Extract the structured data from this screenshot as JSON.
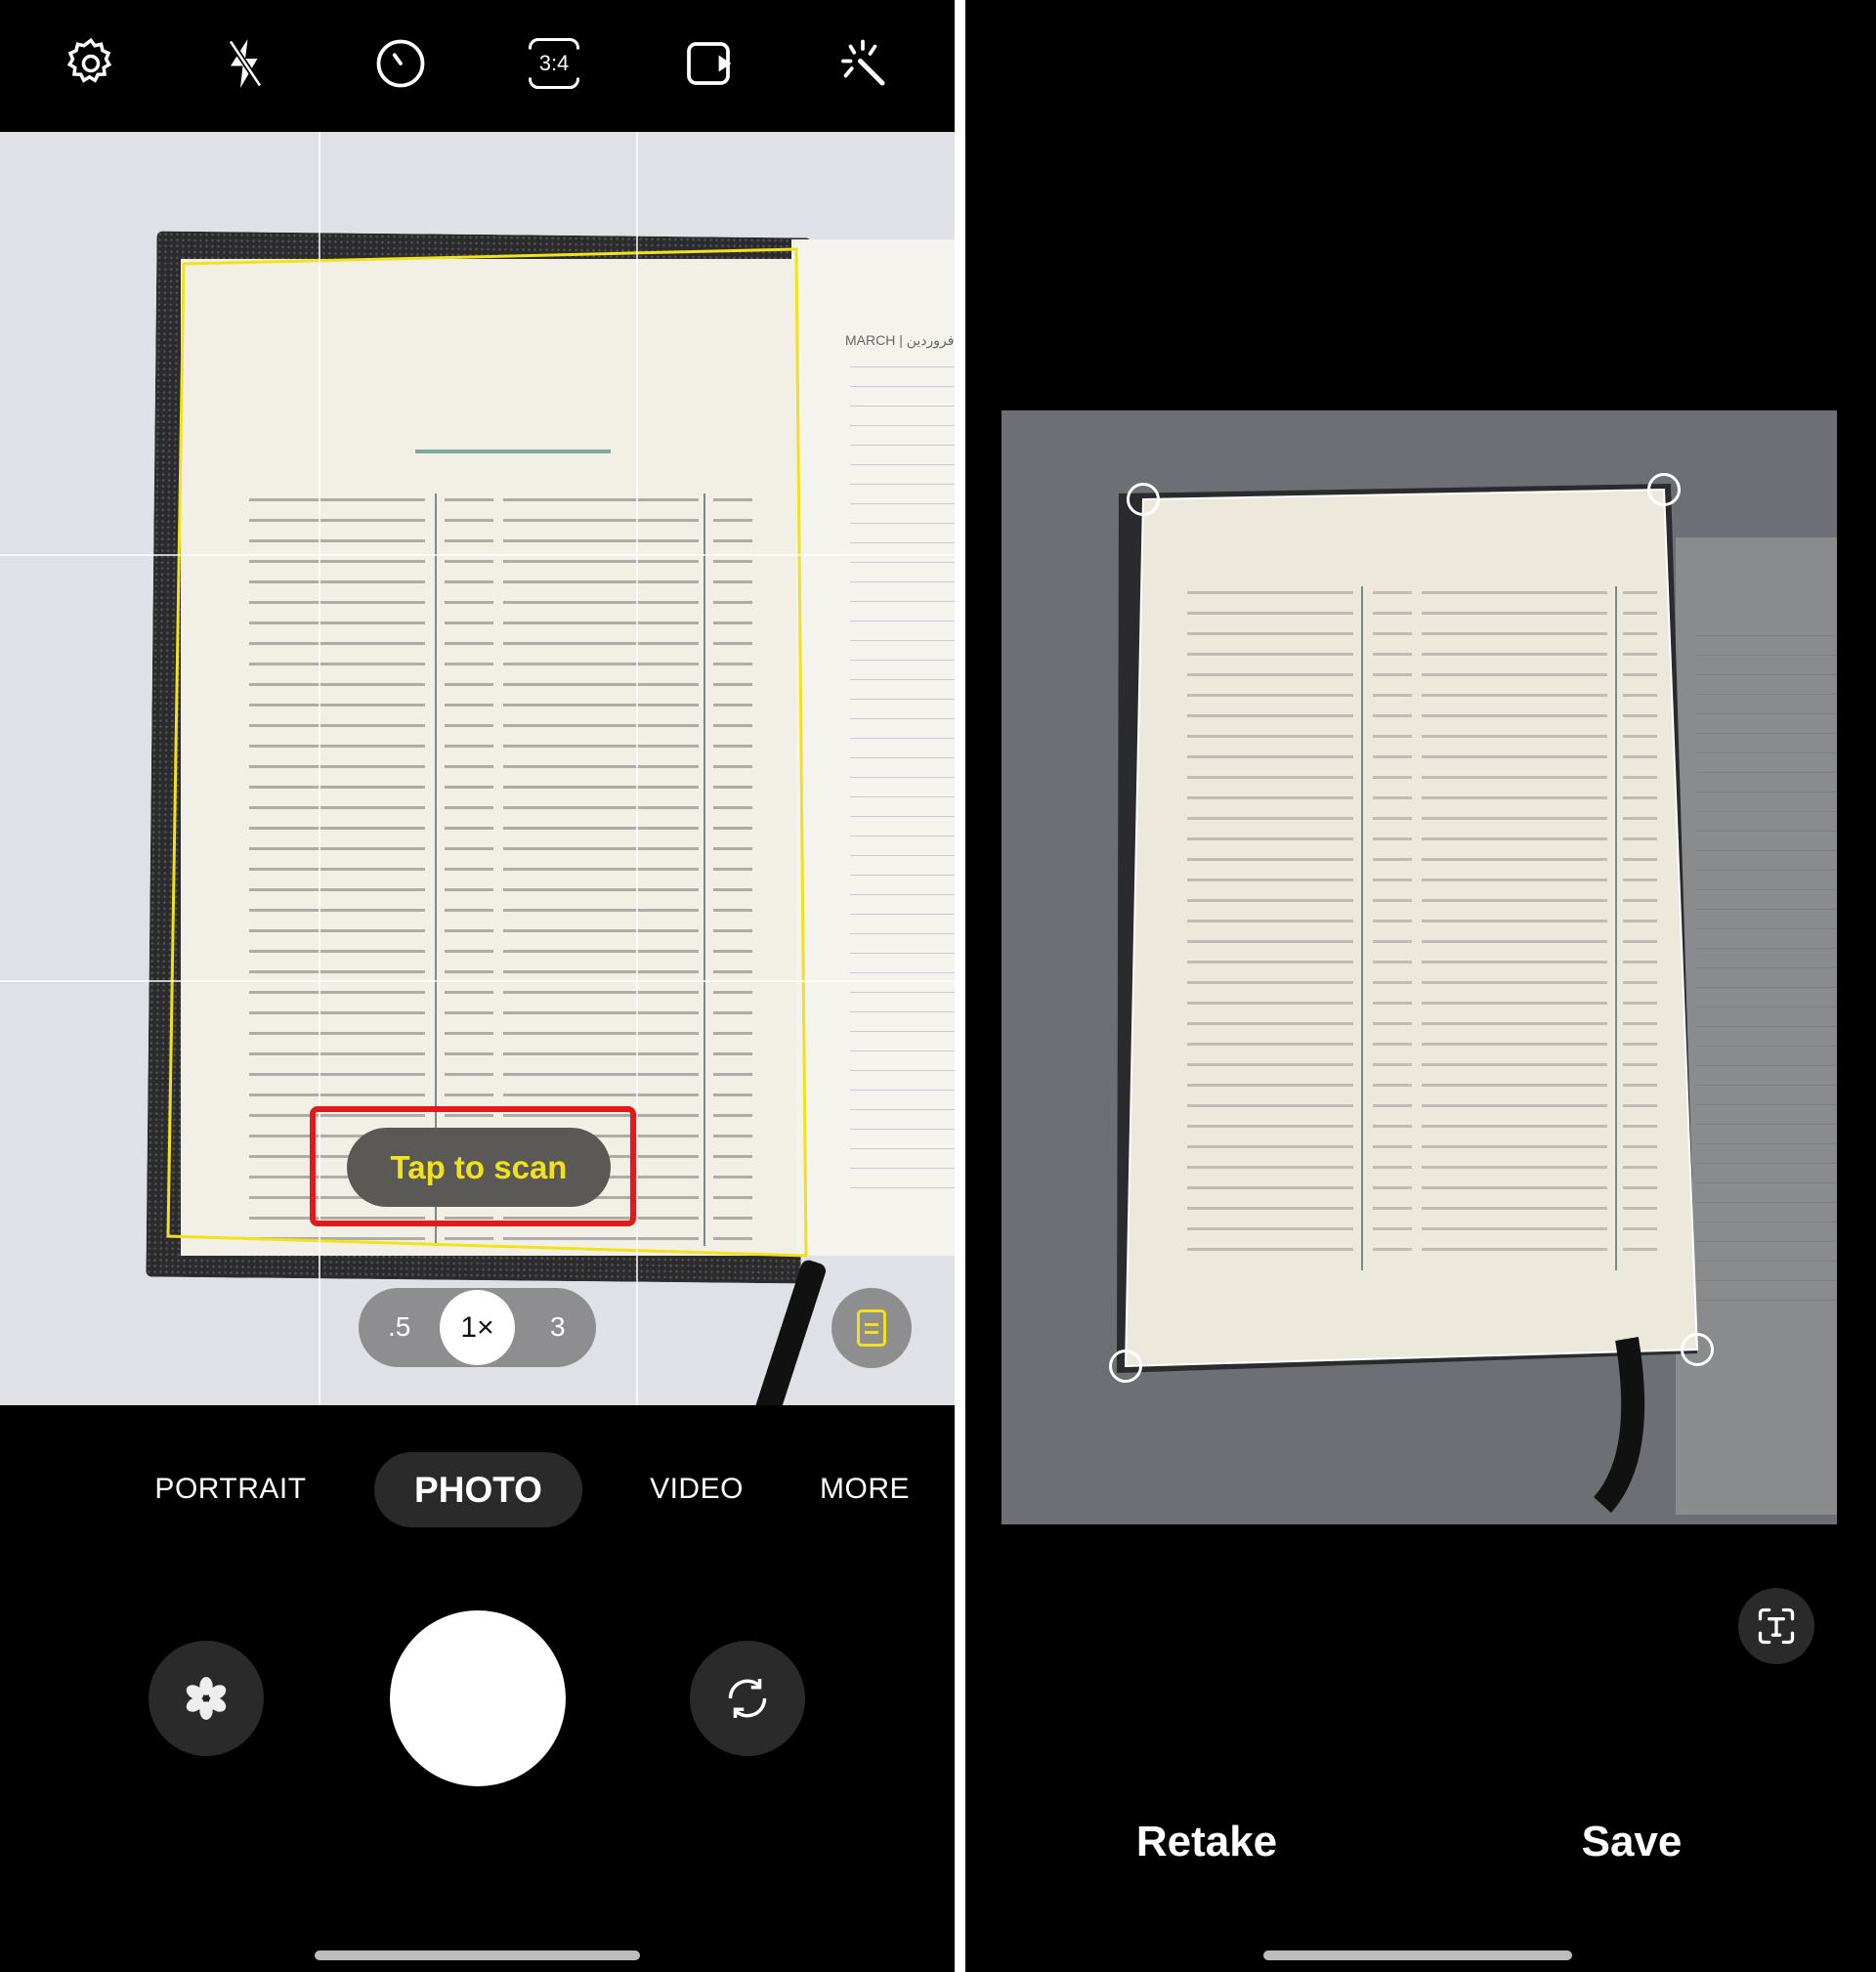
{
  "camera": {
    "top_bar": {
      "icons": [
        "gear-icon",
        "flash-off-icon",
        "timer-icon",
        "aspect-ratio-icon",
        "motion-photo-icon",
        "effects-wand-icon"
      ],
      "aspect_ratio_label": "3:4"
    },
    "viewfinder": {
      "scan_prompt": "Tap to scan",
      "scan_prompt_color": "#f2e21c",
      "highlight_color": "#e01b1b",
      "document_outline_color": "#f2e21c",
      "right_page_header": "MARCH | فروردین",
      "zoom_levels": [
        ".5",
        "1×",
        "3"
      ],
      "selected_zoom": "1×",
      "document_scan_icon": "document-scan-icon"
    },
    "modes": {
      "items": [
        "PORTRAIT",
        "PHOTO",
        "VIDEO",
        "MORE"
      ],
      "selected": "PHOTO"
    },
    "controls": {
      "left": "filters-flower-icon",
      "center": "shutter-button",
      "right": "flip-camera-icon"
    }
  },
  "scan_review": {
    "text_extract_icon": "text-extract-icon",
    "retake_label": "Retake",
    "save_label": "Save"
  }
}
